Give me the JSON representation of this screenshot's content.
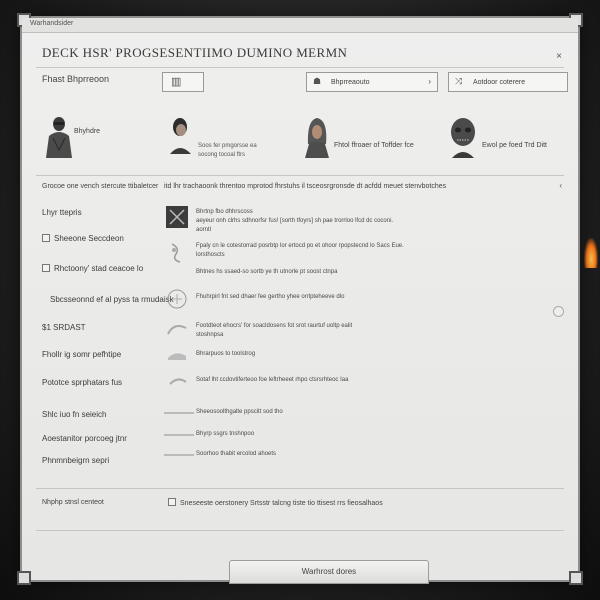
{
  "window": {
    "title": "Warhandsider"
  },
  "header": {
    "heading": "DECK HSR' PROGSESENTIIMO DUMINO MERMN",
    "close_label": "×"
  },
  "filter": {
    "label": "Fhast Bhprreoon",
    "tile_icon": "grid-icon",
    "dropdown_label": "Bhprreaouto",
    "search_label": "Aotdoor coterere"
  },
  "characters": [
    {
      "name": "Bhyhdre",
      "desc": ""
    },
    {
      "name": "",
      "desc": "Soos fer pmgorsse ea\nsocong tocoal ftrs"
    },
    {
      "name": "",
      "desc": "Fhtol ffroaer of Toffder fce"
    },
    {
      "name": "",
      "desc": "Ewol pe foed Trd Ditt"
    }
  ],
  "section": {
    "label": "Grocoe one vench stercute ttibaletcer",
    "desc": "itd lhr trachaoonk threntoo mprotod fhrstuhs il tsceosrgronsde dt acfdd meuet stenvbotches",
    "chevron": "‹"
  },
  "options": [
    {
      "label": "Lhyr ttepris",
      "checkbox": false
    },
    {
      "label": "Sheeone Seccdeon",
      "checkbox": true
    },
    {
      "label": "Rhctoony' stad ceacoe lo",
      "checkbox": true
    },
    {
      "label": "Sbcsseonnd ef al pyss ta rmudaisk",
      "checkbox": false
    },
    {
      "label": "$1 SRDAST",
      "checkbox": false
    },
    {
      "label": "Fhollr ig somr pefhtipe",
      "checkbox": false
    },
    {
      "label": "Pototce sprphatars fus",
      "checkbox": false
    },
    {
      "label": "Shlc iuo fn seieich",
      "checkbox": false
    },
    {
      "label": "Aoestanitor porcoeg jtnr",
      "checkbox": false
    },
    {
      "label": "Phnmnbeigrn sepri",
      "checkbox": false
    }
  ],
  "descriptions": [
    {
      "lines": [
        "Bhrtnp fbo dhhrscoss",
        "aeyeur onh clrhs sdhnorfsr fus! [sorth tfoyrs] sh pae trorrloo lfcd dc coconi.",
        "aorntl"
      ]
    },
    {
      "lines": [
        "Fpaly cn le cotestorrad posrbtp lor ertocd po et ohoor rpopstecnd lo Sacs Eue.",
        "lorsthoscts"
      ]
    },
    {
      "lines": [
        "Bhtnes hs ssaed-so sortb ye th utnorle pt soost ctnpa"
      ]
    },
    {
      "lines": [
        "Fhuhrpirl fnt sed dhaer fee gertho yhee orrlpteheeve dlo"
      ]
    },
    {
      "lines": [
        "Footdteot ehocrs' for soacldosens fot srot raurtuf uoltp ealit",
        "stoshnpsa"
      ]
    },
    {
      "lines": [
        "Bhrarpuos to toolstrog"
      ]
    },
    {
      "lines": [
        "Sotaf lht ccdovtiferteoo foe leftrheeet rhpo ctsrsrhteoc Iaa"
      ]
    },
    {
      "lines": [
        "Sheeosoolthgalte ppscitt sod tho"
      ]
    },
    {
      "lines": [
        "Bhyrp ssgrs tnshnpoo"
      ]
    },
    {
      "lines": [
        "Soorhoo thabit ercolod ahoets"
      ]
    }
  ],
  "footer": {
    "label": "Nhphp stnsl centeot",
    "option": "Sneseeste oerstonery Srtsstr talcng tiste tio ttisest rrs fieosalhaos"
  },
  "bottom_button": {
    "label": "Warhrost dores"
  }
}
